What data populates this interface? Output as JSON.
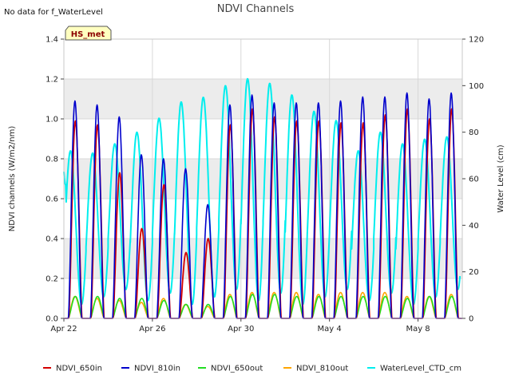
{
  "no_data_note": "No data for f_WaterLevel",
  "site_badge": "HS_met",
  "colors": {
    "NDVI_650in": "#d40000",
    "NDVI_810in": "#0000cc",
    "NDVI_650out": "#22dd22",
    "NDVI_810out": "#ffa500",
    "WaterLevel_CTD_cm": "#00eeee",
    "band": "#ececec",
    "badge_fill": "#ffffc0"
  },
  "chart_data": {
    "type": "line",
    "title": "NDVI Channels",
    "ylabel": "NDVI channels (W/m2/nm)",
    "y2label": "Water Level (cm)",
    "ylim": [
      0,
      1.4
    ],
    "y2lim": [
      0,
      120
    ],
    "xlim": [
      "Apr 22",
      "May 10"
    ],
    "x_ticks": [
      "Apr 22",
      "Apr 26",
      "Apr 30",
      "May 4",
      "May 8"
    ],
    "y_ticks": [
      "0.0",
      "0.2",
      "0.4",
      "0.6",
      "0.8",
      "1.0",
      "1.2",
      "1.4"
    ],
    "y2_ticks": [
      "0",
      "20",
      "40",
      "60",
      "80",
      "100",
      "120"
    ],
    "grid": true,
    "legend_position": "bottom",
    "series": [
      {
        "name": "NDVI_650in",
        "axis": "left",
        "daily_peaks": [
          0.99,
          0.97,
          0.73,
          0.45,
          0.67,
          0.33,
          0.4,
          0.97,
          1.05,
          1.01,
          0.99,
          0.99,
          0.98,
          0.98,
          1.02,
          1.05,
          1.0,
          1.05
        ]
      },
      {
        "name": "NDVI_810in",
        "axis": "left",
        "daily_peaks": [
          1.09,
          1.07,
          1.01,
          0.82,
          0.8,
          0.75,
          0.57,
          1.07,
          1.12,
          1.08,
          1.08,
          1.08,
          1.09,
          1.11,
          1.11,
          1.13,
          1.1,
          1.13
        ]
      },
      {
        "name": "NDVI_650out",
        "axis": "left",
        "daily_peaks": [
          0.11,
          0.11,
          0.1,
          0.1,
          0.09,
          0.07,
          0.07,
          0.11,
          0.12,
          0.12,
          0.11,
          0.11,
          0.11,
          0.11,
          0.11,
          0.1,
          0.11,
          0.11
        ]
      },
      {
        "name": "NDVI_810out",
        "axis": "left",
        "daily_peaks": [
          0.11,
          0.1,
          0.09,
          0.08,
          0.1,
          0.07,
          0.06,
          0.12,
          0.13,
          0.13,
          0.13,
          0.12,
          0.13,
          0.13,
          0.13,
          0.11,
          0.11,
          0.12
        ]
      },
      {
        "name": "WaterLevel_CTD_cm",
        "axis": "right",
        "start_value": 63,
        "daily_peaks": [
          72,
          71,
          75,
          80,
          86,
          93,
          95,
          100,
          103,
          101,
          96,
          89,
          85,
          72,
          80,
          75,
          77,
          78
        ]
      }
    ]
  }
}
